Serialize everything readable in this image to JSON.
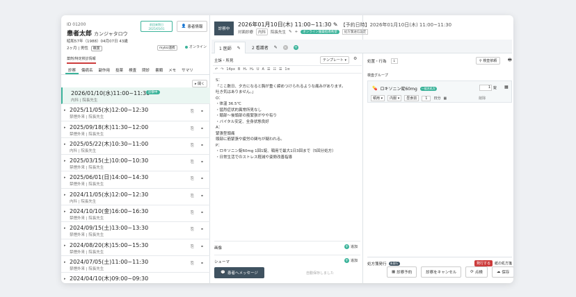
{
  "patient": {
    "id": "01200",
    "name": "患者太郎",
    "kana": "カンジャタロウ",
    "birth": "昭和57年（1988）04月07日 43歳",
    "period": "2ヶ月",
    "gender": "男性",
    "chip": "職業",
    "visit_box": "前回来院日\n2025/05/01",
    "info_button": "患者情報",
    "mynumber": "mybiz連携",
    "online_label": "オンライン",
    "sub_note": "薬剤/特定検診情報"
  },
  "left_tabs": [
    "診察",
    "傷病名",
    "副作用",
    "投薬",
    "検査",
    "問診",
    "書類",
    "メモ",
    "サマリ"
  ],
  "expand_label": "開く",
  "visits": [
    {
      "dt": "2026/01/10(水)11:00~11:30",
      "dept": "内科 | 院長先生",
      "badge": "診察中",
      "sel": true
    },
    {
      "dt": "2025/11/05(水)12:00~12:30",
      "dept": "禁煙外来 | 院長先生"
    },
    {
      "dt": "2025/09/18(木)11:30~12:00",
      "dept": "禁煙外来 | 院長先生"
    },
    {
      "dt": "2025/05/22(木)10:30~11:00",
      "dept": "内科 | 院長先生"
    },
    {
      "dt": "2025/03/15(土)10:00~10:30",
      "dept": "禁煙外来 | 院長先生"
    },
    {
      "dt": "2025/06/01(日)14:00~14:30",
      "dept": "禁煙外来 | 院長先生"
    },
    {
      "dt": "2024/11/05(水)12:00~12:30",
      "dept": "内科 | 院長先生"
    },
    {
      "dt": "2024/10/10(金)16:00~16:30",
      "dept": "禁煙外来 | 院長先生"
    },
    {
      "dt": "2024/09/15(土)13:00~13:30",
      "dept": "禁煙外来 | 院長先生"
    },
    {
      "dt": "2024/08/20(木)15:00~15:30",
      "dept": "禁煙外来 | 院長先生"
    },
    {
      "dt": "2024/07/05(土)11:00~11:30",
      "dept": "禁煙外来 | 院長先生"
    },
    {
      "dt": "2024/04/10(木)09:00~09:30",
      "dept": ""
    }
  ],
  "encounter": {
    "status": "診察中",
    "datetime": "2026年01月10日(木) 11:00~11:30",
    "reserve": "【予約日時】2026年01月10日(木) 11:00~11:30",
    "type": "対面診療",
    "dept": "内科",
    "doctor": "院長先生",
    "online_badge": "オンライン服薬指導希望",
    "rx_link": "処方箋送信設定"
  },
  "doc_tabs": [
    {
      "label": "1 医師",
      "active": true
    },
    {
      "label": "2 看護者",
      "active": false
    }
  ],
  "editor": {
    "header": "主訴・所見",
    "template": "テンプレート",
    "toolbar": [
      "↶",
      "↷",
      "14px",
      "B",
      "H₁",
      "H₂",
      "U",
      "A",
      "☰",
      "☷",
      "☰",
      "1≡"
    ],
    "lines": [
      "S：",
      "「ここ数日、夕方になると胸が重く締めつけられるような痛みがあります。",
      "吐き気はありません。」",
      "O：",
      "・体温 36.5℃",
      "・猛烈症状的異常所見なし",
      "・頸部〜後頭部の筋緊張がやや有り",
      "・バイタル安定、全身状態良好",
      "A：",
      "緊張型頭痛",
      "頭部に筋緊張や疲労の関与が疑われる。",
      "P：",
      "・ロキソニン錠60mg 1回1錠、頓用で最大1日3回まで（5回分処方）",
      "・日常生活でのストレス軽減や姿勢改善指導"
    ],
    "image_label": "画像",
    "schema_label": "シェーマ",
    "add_label": "追加"
  },
  "orders": {
    "header": "処置・行為",
    "search": "検査依頼",
    "group": "検査グループ",
    "drug_name": "ロキソニン錠60mg",
    "generic": "一般名処方",
    "qty": "1",
    "unit": "錠",
    "route": "頓用",
    "form": "内服",
    "freq": "昼食前",
    "days": "1",
    "days_unit": "日分",
    "remove": "削除",
    "rx_label": "処方箋発行",
    "rx_status": "未発行",
    "issue": "発行する",
    "paper": "紙の処方箋"
  },
  "footer": {
    "message": "患者へメッセージ",
    "autosave": "自動保存しました",
    "buttons": [
      "診察予約",
      "診察をキャンセル",
      "点検",
      "保存"
    ]
  },
  "colors": {
    "accent": "#3bb39a",
    "dark": "#3f5260",
    "danger": "#cc3b3b"
  }
}
